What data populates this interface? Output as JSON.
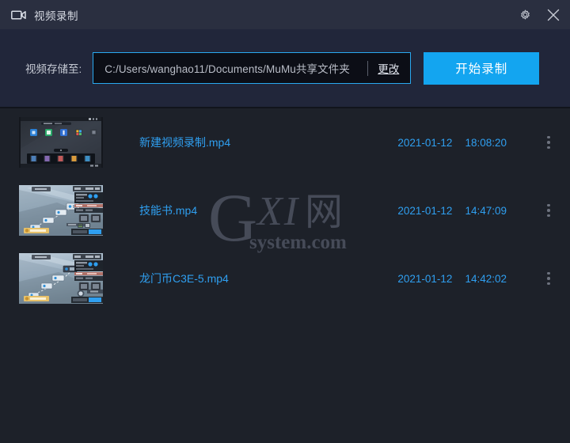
{
  "window": {
    "title": "视频录制",
    "app_icon": "video-camera-icon",
    "settings_icon": "gear-icon",
    "close_icon": "close-icon"
  },
  "path_bar": {
    "label": "视频存储至:",
    "value": "C:/Users/wanghao11/Documents/MuMu共享文件夹",
    "placeholder": "C:/Users/wanghao11/Documents/MuMu共享文件夹",
    "change_label": "更改",
    "record_button": "开始录制"
  },
  "colors": {
    "accent": "#13a5f0",
    "link": "#2f9ff0",
    "titlebar_bg": "#2a2f40",
    "pathbar_bg": "#21263a",
    "body_bg": "#1d2129",
    "input_border": "#29a9f0"
  },
  "watermark": {
    "g": "G",
    "xi": "XI",
    "net": "网",
    "system": "system.com"
  },
  "files": [
    {
      "name": "新建视频录制.mp4",
      "date": "2021-01-12",
      "time": "18:08:20",
      "thumbnail": "android-home-screen-thumbnail",
      "menu_icon": "more-vertical-icon"
    },
    {
      "name": "技能书.mp4",
      "date": "2021-01-12",
      "time": "14:47:09",
      "thumbnail": "game-map-thumbnail",
      "menu_icon": "more-vertical-icon"
    },
    {
      "name": "龙门币C3E-5.mp4",
      "date": "2021-01-12",
      "time": "14:42:02",
      "thumbnail": "game-map-thumbnail",
      "menu_icon": "more-vertical-icon"
    }
  ]
}
